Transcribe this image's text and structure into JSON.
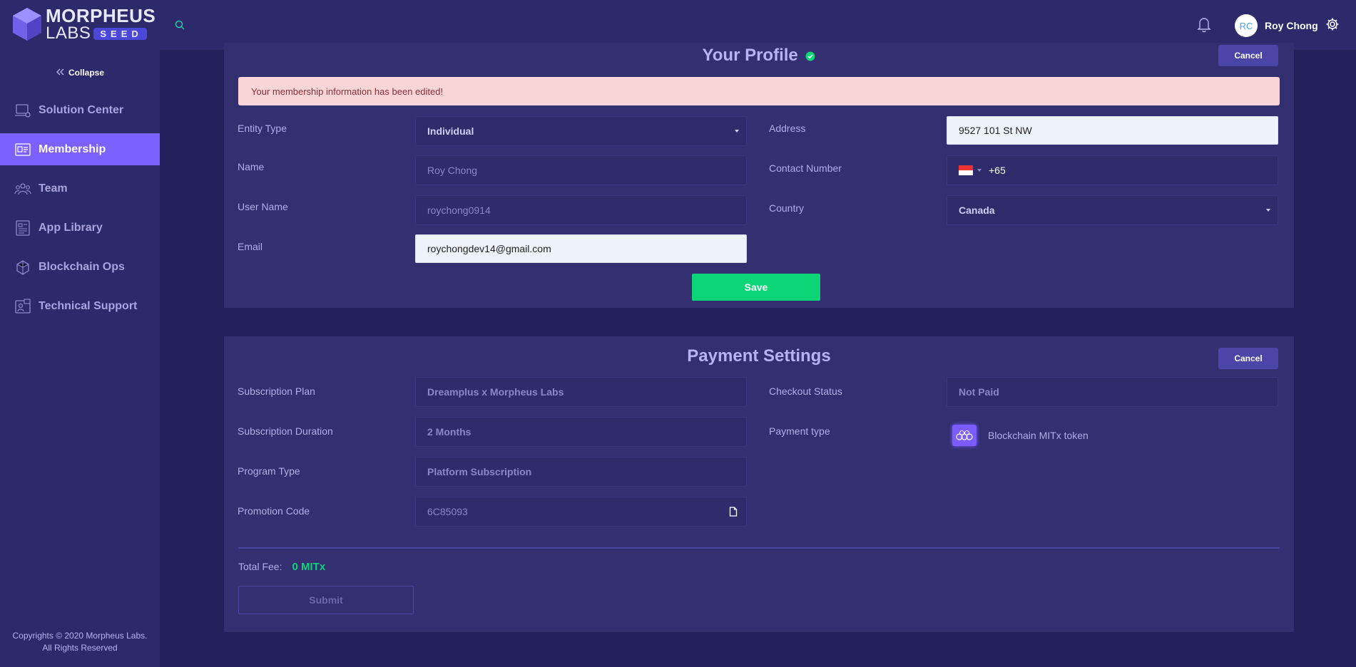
{
  "brand": {
    "name_top": "MORPHEUS",
    "name_bottom": "LABS",
    "tag": "SEED"
  },
  "sidebar": {
    "collapse_label": "Collapse",
    "items": [
      {
        "label": "Solution Center",
        "icon": "solution-center-icon"
      },
      {
        "label": "Membership",
        "icon": "membership-icon",
        "active": true
      },
      {
        "label": "Team",
        "icon": "team-icon"
      },
      {
        "label": "App Library",
        "icon": "app-library-icon"
      },
      {
        "label": "Blockchain Ops",
        "icon": "blockchain-ops-icon"
      },
      {
        "label": "Technical Support",
        "icon": "technical-support-icon"
      }
    ],
    "copyright_line1": "Copyrights © 2020 Morpheus Labs.",
    "copyright_line2": "All Rights Reserved"
  },
  "header": {
    "user_initials": "RC",
    "user_name": "Roy Chong"
  },
  "profile": {
    "title": "Your Profile",
    "cancel_label": "Cancel",
    "alert": "Your membership information has been edited!",
    "entity_type_label": "Entity Type",
    "entity_type_value": "Individual",
    "name_label": "Name",
    "name_value": "Roy Chong",
    "username_label": "User Name",
    "username_value": "roychong0914",
    "email_label": "Email",
    "email_value": "roychongdev14@gmail.com",
    "address_label": "Address",
    "address_value": "9527 101 St NW",
    "contact_label": "Contact Number",
    "contact_value": "+65",
    "country_label": "Country",
    "country_value": "Canada",
    "save_label": "Save"
  },
  "payment": {
    "title": "Payment Settings",
    "cancel_label": "Cancel",
    "plan_label": "Subscription Plan",
    "plan_value": "Dreamplus x Morpheus Labs",
    "duration_label": "Subscription Duration",
    "duration_value": "2 Months",
    "program_label": "Program Type",
    "program_value": "Platform Subscription",
    "promo_label": "Promotion Code",
    "promo_value": "6C85093",
    "checkout_label": "Checkout Status",
    "checkout_value": "Not Paid",
    "paytype_label": "Payment type",
    "paytype_value": "Blockchain MITx token",
    "total_label": "Total Fee:",
    "total_value": "0 MITx",
    "submit_label": "Submit"
  },
  "colors": {
    "accent": "#7b61ff",
    "success": "#0cd577",
    "background": "#23205b",
    "panel": "#332f70"
  }
}
